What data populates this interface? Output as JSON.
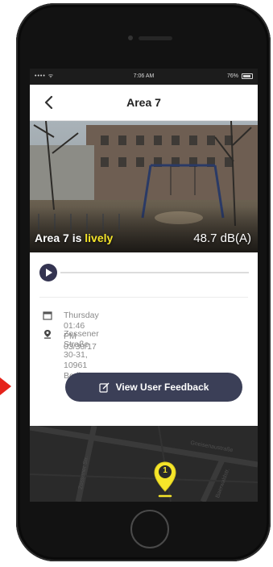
{
  "status_bar": {
    "signal": "•••• ᯤ",
    "time": "7:06 AM",
    "battery_text": "76%"
  },
  "nav": {
    "title": "Area 7",
    "back_icon": "chevron-left-icon"
  },
  "photo": {
    "caption_prefix": "Area 7 is ",
    "caption_highlight": "lively",
    "decibel": "48.7 dB(A)"
  },
  "player": {
    "play_icon": "play-icon"
  },
  "info": {
    "date_text": "Thursday 01:46 PM 03/30/17",
    "address_line1": "Zossener Straße 30-31, 10961",
    "address_line2": "Berlin"
  },
  "feedback_button": {
    "label": "View User Feedback",
    "icon": "edit-icon"
  },
  "map": {
    "street_1": "Gneisenaustraße",
    "street_2": "Zossener Str.",
    "street_3": "Baerwaldstr.",
    "pin_number": "1"
  },
  "colors": {
    "highlight": "#f5e52a",
    "button": "#3b3f57",
    "pin": "#f5e52a",
    "arrow": "#e5231b"
  }
}
